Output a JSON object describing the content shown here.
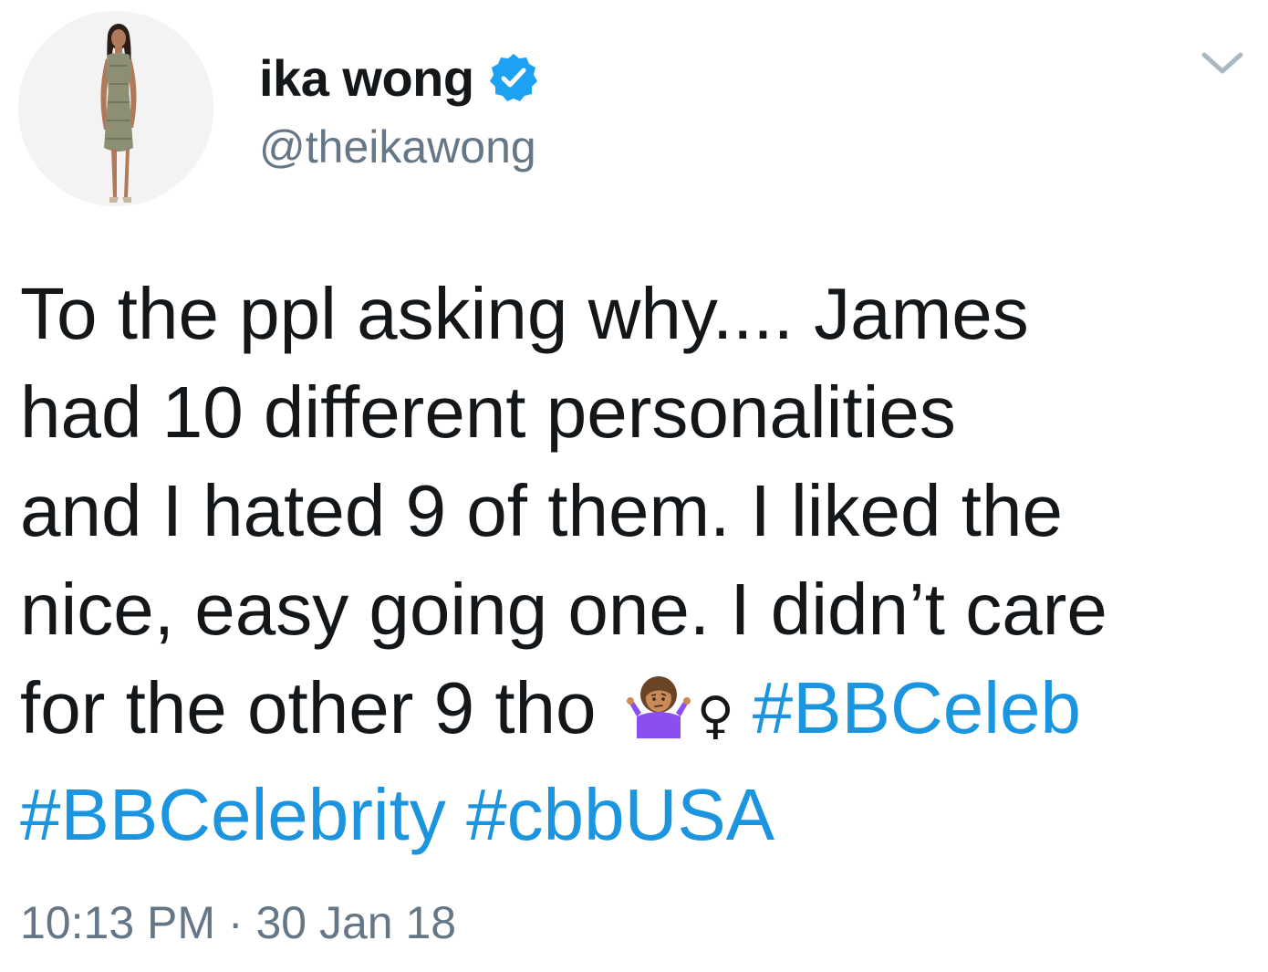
{
  "author": {
    "display_name": "ika wong",
    "handle": "@theikawong",
    "verified": true,
    "verified_color": "#1da1f2"
  },
  "tweet": {
    "line1": "To the ppl asking why.... James",
    "line2": "had 10 different personalities",
    "line3": "and I hated 9 of them.  I liked the",
    "line4": "nice, easy going one.  I didn’t care",
    "line5_text": "for the other 9 tho",
    "emoji_name": "woman-shrugging",
    "female_sign": "♀",
    "hashtag1": "#BBCeleb",
    "hashtag2": "#BBCelebrity",
    "hashtag3": "#cbbUSA",
    "hashtag_color": "#1b95e0"
  },
  "meta": {
    "time": "10:13 PM",
    "separator": "·",
    "date": "30 Jan 18"
  },
  "icons": {
    "menu": "chevron-down-icon",
    "verified": "verified-badge-icon"
  }
}
